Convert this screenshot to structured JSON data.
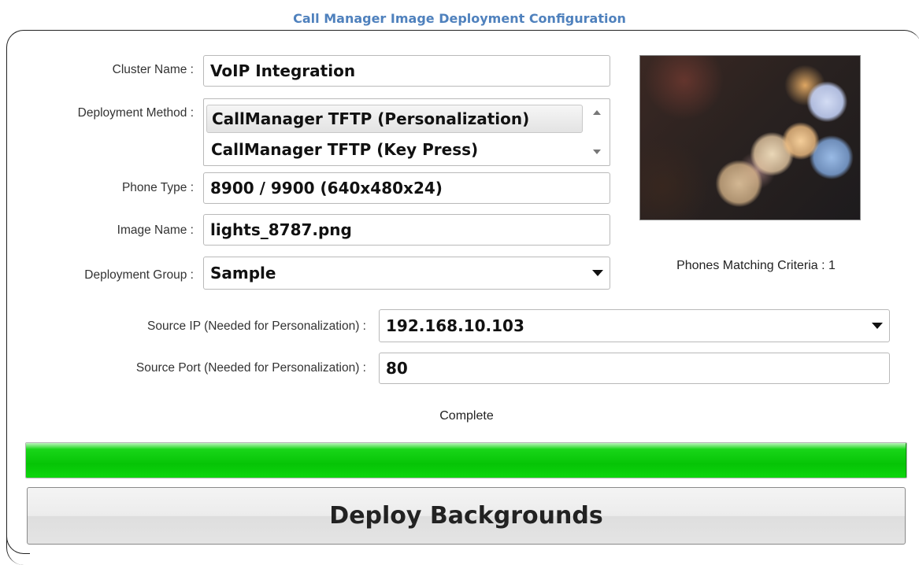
{
  "header": {
    "title": "Call Manager Image Deployment Configuration"
  },
  "form": {
    "cluster_name": {
      "label": "Cluster Name :",
      "value": "VoIP Integration"
    },
    "deployment_method": {
      "label": "Deployment Method :",
      "options": [
        "CallManager TFTP (Personalization)",
        "CallManager TFTP (Key Press)"
      ],
      "selected": "CallManager TFTP (Personalization)"
    },
    "phone_type": {
      "label": "Phone Type :",
      "value": "8900 / 9900 (640x480x24)"
    },
    "image_name": {
      "label": "Image Name :",
      "value": "lights_8787.png"
    },
    "deployment_group": {
      "label": "Deployment Group :",
      "value": "Sample"
    },
    "source_ip": {
      "label": "Source IP (Needed for Personalization) :",
      "value": "192.168.10.103"
    },
    "source_port": {
      "label": "Source Port (Needed for Personalization) :",
      "value": "80"
    }
  },
  "preview": {
    "matching_text": "Phones Matching Criteria : 1"
  },
  "status": {
    "text": "Complete",
    "progress_percent": 100,
    "progress_color": "#06c406"
  },
  "actions": {
    "deploy_label": "Deploy Backgrounds"
  }
}
